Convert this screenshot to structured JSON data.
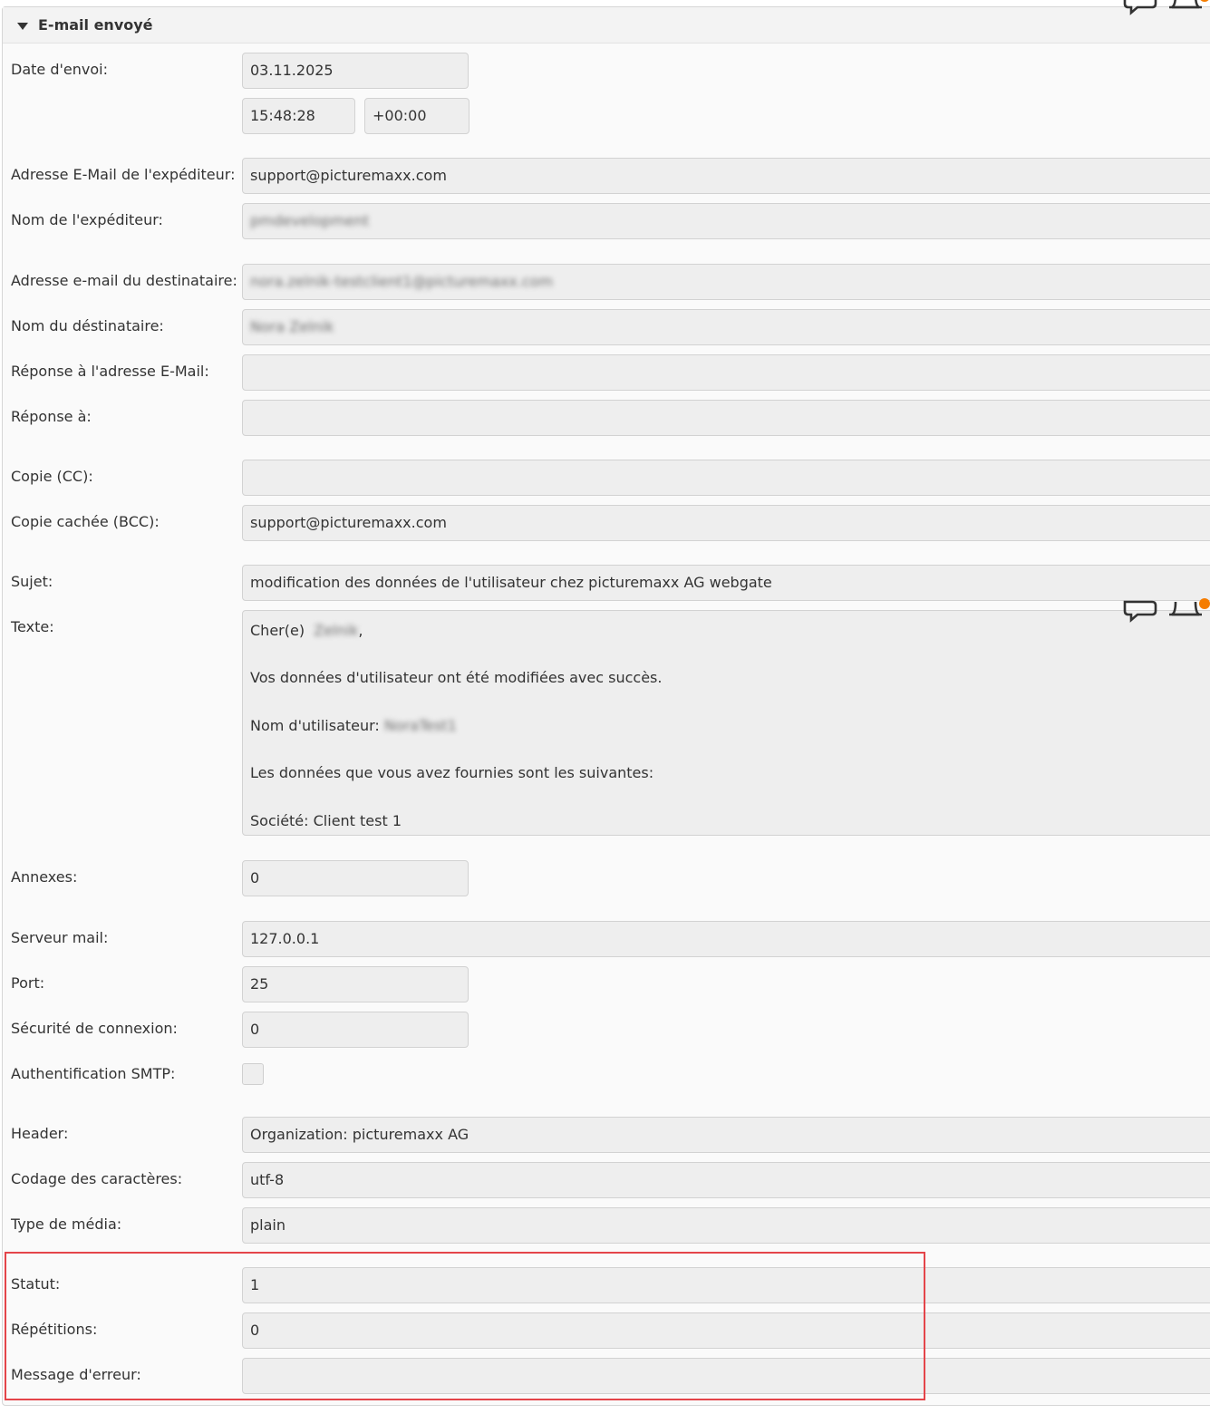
{
  "panel": {
    "title": "E-mail envoyé"
  },
  "fields": {
    "send_date": {
      "label": "Date d'envoi:",
      "date": "03.11.2025",
      "time": "15:48:28",
      "timezone": "+00:00"
    },
    "sender_email": {
      "label": "Adresse E-Mail de l'expéditeur:",
      "value": "support@picturemaxx.com"
    },
    "sender_name": {
      "label": "Nom de l'expéditeur:",
      "value": "pmdevelopment"
    },
    "recipient_email": {
      "label": "Adresse e-mail du destinataire:",
      "value": "nora.zelnik-testclient1@picturemaxx.com"
    },
    "recipient_name": {
      "label": "Nom du déstinataire:",
      "value": "Nora Zelnik"
    },
    "reply_to_email": {
      "label": "Réponse à l'adresse E-Mail:",
      "value": ""
    },
    "reply_to": {
      "label": "Réponse à:",
      "value": ""
    },
    "cc": {
      "label": "Copie (CC):",
      "value": ""
    },
    "bcc": {
      "label": "Copie cachée (BCC):",
      "value": "support@picturemaxx.com"
    },
    "subject": {
      "label": "Sujet:",
      "value": "modification des données de l'utilisateur chez picturemaxx AG webgate"
    },
    "text": {
      "label": "Texte:",
      "greeting_prefix": "Cher(e)",
      "greeting_name": "Zelnik",
      "greeting_suffix": ",",
      "line_success": "Vos données d'utilisateur ont été modifiées avec succès.",
      "username_label": "Nom d'utilisateur:",
      "username_value": "NoraTest1",
      "line_data": "Les données que vous avez fournies sont les suivantes:",
      "line_company": "Société: Client test 1"
    },
    "attachments": {
      "label": "Annexes:",
      "value": "0"
    },
    "mail_server": {
      "label": "Serveur mail:",
      "value": "127.0.0.1"
    },
    "port": {
      "label": "Port:",
      "value": "25"
    },
    "connection_security": {
      "label": "Sécurité de connexion:",
      "value": "0"
    },
    "smtp_auth": {
      "label": "Authentification SMTP:",
      "checked": false
    },
    "header": {
      "label": "Header:",
      "value": "Organization: picturemaxx AG"
    },
    "charset": {
      "label": "Codage des caractères:",
      "value": "utf-8"
    },
    "media_type": {
      "label": "Type de média:",
      "value": "plain"
    },
    "status": {
      "label": "Statut:",
      "value": "1"
    },
    "repetitions": {
      "label": "Répétitions:",
      "value": "0"
    },
    "error_message": {
      "label": "Message d'erreur:",
      "value": ""
    }
  },
  "icons": [
    "chat-icon",
    "bell-icon",
    "notification-badge"
  ],
  "colors": {
    "highlight": "#e4454a",
    "badge": "#f57c00"
  }
}
